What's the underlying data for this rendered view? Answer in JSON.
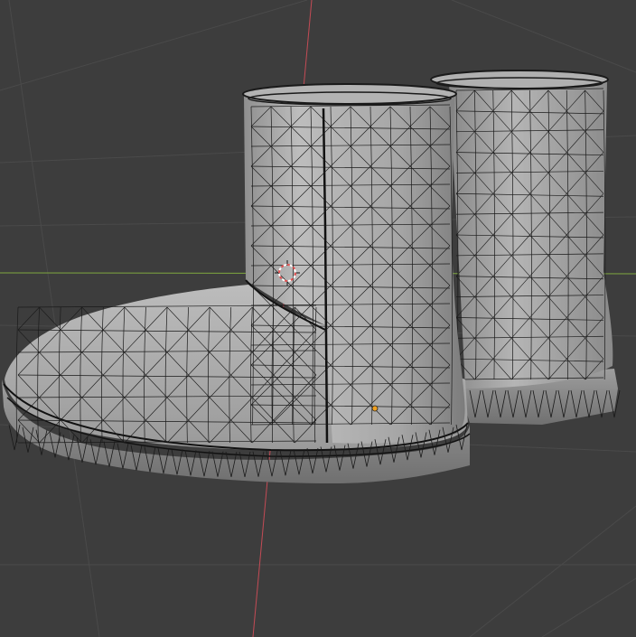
{
  "viewport": {
    "name": "3d-viewport",
    "background_color": "#3d3d3d",
    "grid_color": "#4a4a4a",
    "x_axis_color": "#7fa83f",
    "y_axis_color": "#c44b55",
    "mesh_fill_color": "#a9a9a9",
    "mesh_shadow_color": "#8c8c8c",
    "wire_color": "#1a1a1a",
    "cursor_color_a": "#e05050",
    "cursor_color_b": "#ffffff",
    "origin_color": "#f0a020"
  },
  "scene": {
    "objects": [
      {
        "name": "boot-front",
        "kind": "mesh"
      },
      {
        "name": "boot-back",
        "kind": "mesh"
      }
    ],
    "display_mode": "wireframe-overlay",
    "icons": {
      "cursor": "3d-cursor-icon",
      "origin": "object-origin-icon"
    }
  }
}
